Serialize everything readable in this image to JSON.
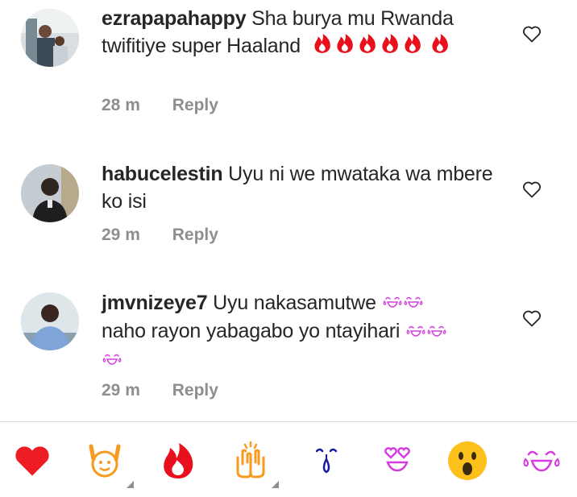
{
  "comments": [
    {
      "username": "ezrapapahappy",
      "text": "Sha burya mu Rwanda twifitiye super  Haaland",
      "emoji_trail": "🔥🔥🔥🔥🔥🔥",
      "time": "28 m",
      "reply_label": "Reply"
    },
    {
      "username": "habucelestin",
      "text": "Uyu ni we mwataka wa mbere ko isi",
      "emoji_trail": "",
      "time": "29 m",
      "reply_label": "Reply"
    },
    {
      "username": "jmvnizeye7",
      "text": "Uyu nakasamutwe 😂😂 naho rayon yabagabo yo ntayihari 😂😂😂",
      "emoji_trail": "",
      "time": "29 m",
      "reply_label": "Reply"
    }
  ],
  "emoji_bar": [
    {
      "name": "red-heart",
      "char": "❤️"
    },
    {
      "name": "raising-hands",
      "char": "🙌"
    },
    {
      "name": "fire",
      "char": "🔥"
    },
    {
      "name": "clapping-hands",
      "char": "👏"
    },
    {
      "name": "crying-face",
      "char": "😢"
    },
    {
      "name": "heart-eyes",
      "char": "😍"
    },
    {
      "name": "astonished-face",
      "char": "😮"
    },
    {
      "name": "tears-of-joy",
      "char": "😂"
    }
  ],
  "colors": {
    "fire": "#e8101c",
    "heart": "#ed1c24",
    "laugh": "#d63be0",
    "orange": "#f79a1e",
    "yellow": "#fcc21b",
    "meta": "#8e8e8e"
  }
}
